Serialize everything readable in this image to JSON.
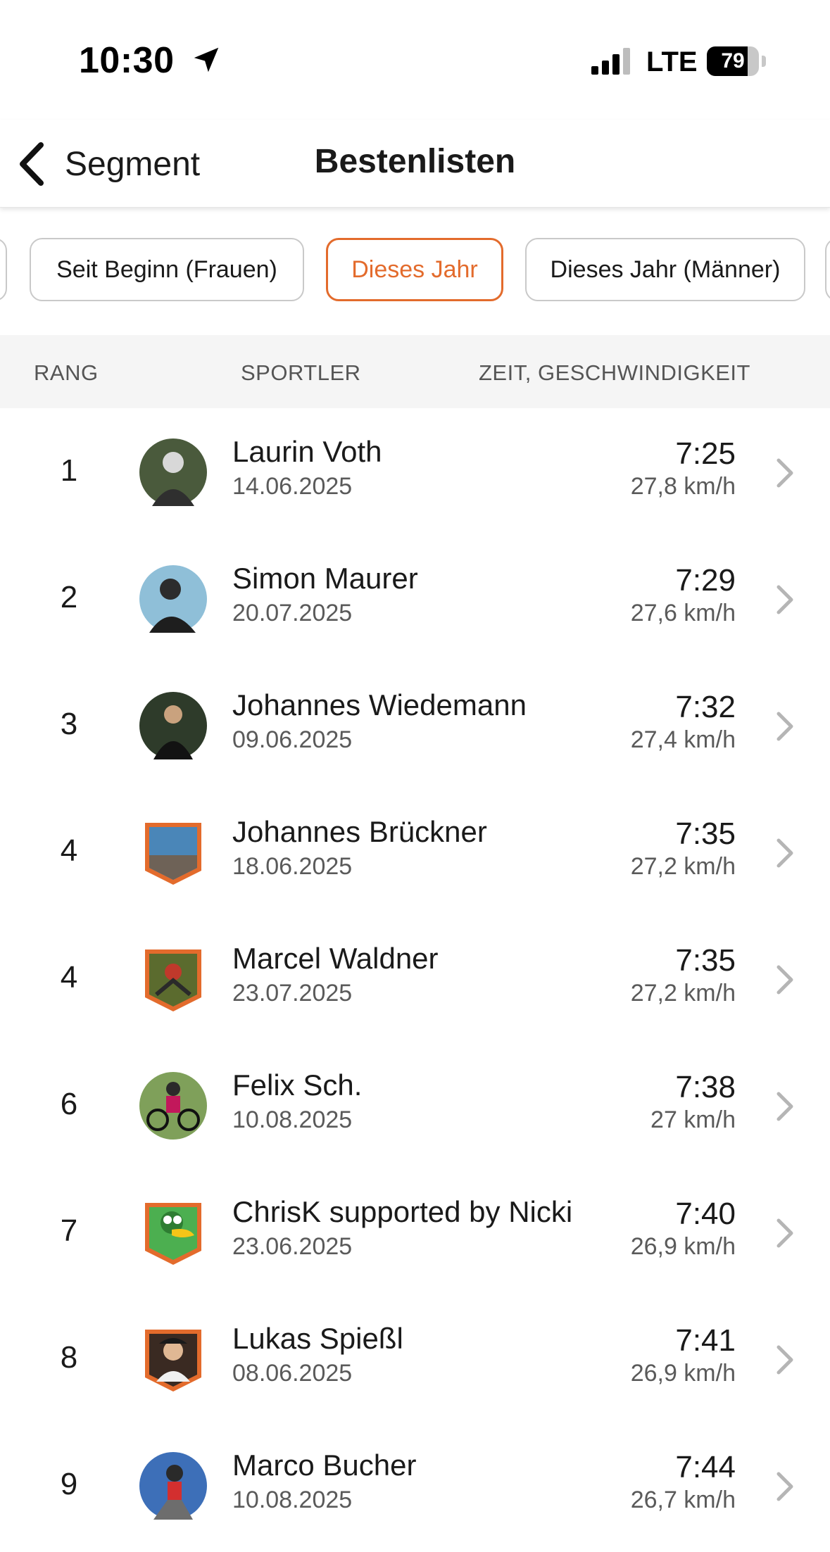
{
  "status_bar": {
    "time": "10:30",
    "network": "LTE",
    "battery": "79",
    "battery_level": 0.79
  },
  "nav": {
    "back_label": "Segment",
    "title": "Bestenlisten"
  },
  "filters": [
    "",
    "Seit Beginn (Frauen)",
    "Dieses Jahr",
    "Dieses Jahr (Männer)",
    ""
  ],
  "active_filter": "Dieses Jahr",
  "table_header": {
    "rank": "RANG",
    "athlete": "SPORTLER",
    "time_speed": "ZEIT, GESCHWINDIGKEIT"
  },
  "rows": [
    {
      "rank": "1",
      "name": "Laurin Voth",
      "date": "14.06.2025",
      "time": "7:25",
      "speed": "27,8 km/h",
      "avatar": "circle"
    },
    {
      "rank": "2",
      "name": "Simon Maurer",
      "date": "20.07.2025",
      "time": "7:29",
      "speed": "27,6 km/h",
      "avatar": "circle"
    },
    {
      "rank": "3",
      "name": "Johannes Wiedemann",
      "date": "09.06.2025",
      "time": "7:32",
      "speed": "27,4 km/h",
      "avatar": "circle"
    },
    {
      "rank": "4",
      "name": "Johannes Brückner",
      "date": "18.06.2025",
      "time": "7:35",
      "speed": "27,2 km/h",
      "avatar": "shield"
    },
    {
      "rank": "4",
      "name": "Marcel Waldner",
      "date": "23.07.2025",
      "time": "7:35",
      "speed": "27,2 km/h",
      "avatar": "shield"
    },
    {
      "rank": "6",
      "name": "Felix Sch.",
      "date": "10.08.2025",
      "time": "7:38",
      "speed": "27 km/h",
      "avatar": "circle"
    },
    {
      "rank": "7",
      "name": "ChrisK supported by Nicki",
      "date": "23.06.2025",
      "time": "7:40",
      "speed": "26,9 km/h",
      "avatar": "shield"
    },
    {
      "rank": "8",
      "name": "Lukas Spießl",
      "date": "08.06.2025",
      "time": "7:41",
      "speed": "26,9 km/h",
      "avatar": "shield"
    },
    {
      "rank": "9",
      "name": "Marco Bucher",
      "date": "10.08.2025",
      "time": "7:44",
      "speed": "26,7 km/h",
      "avatar": "circle"
    }
  ],
  "colors": {
    "accent": "#e36b2c",
    "header_bg": "#f5f5f5",
    "chip_border": "#c9c9c9",
    "subtext": "#5a5a5a"
  },
  "icons": {
    "back": "chevron-left-icon",
    "row": "chevron-right-icon",
    "location": "location-arrow-icon",
    "signal": "cell-signal-icon",
    "battery": "battery-icon"
  }
}
